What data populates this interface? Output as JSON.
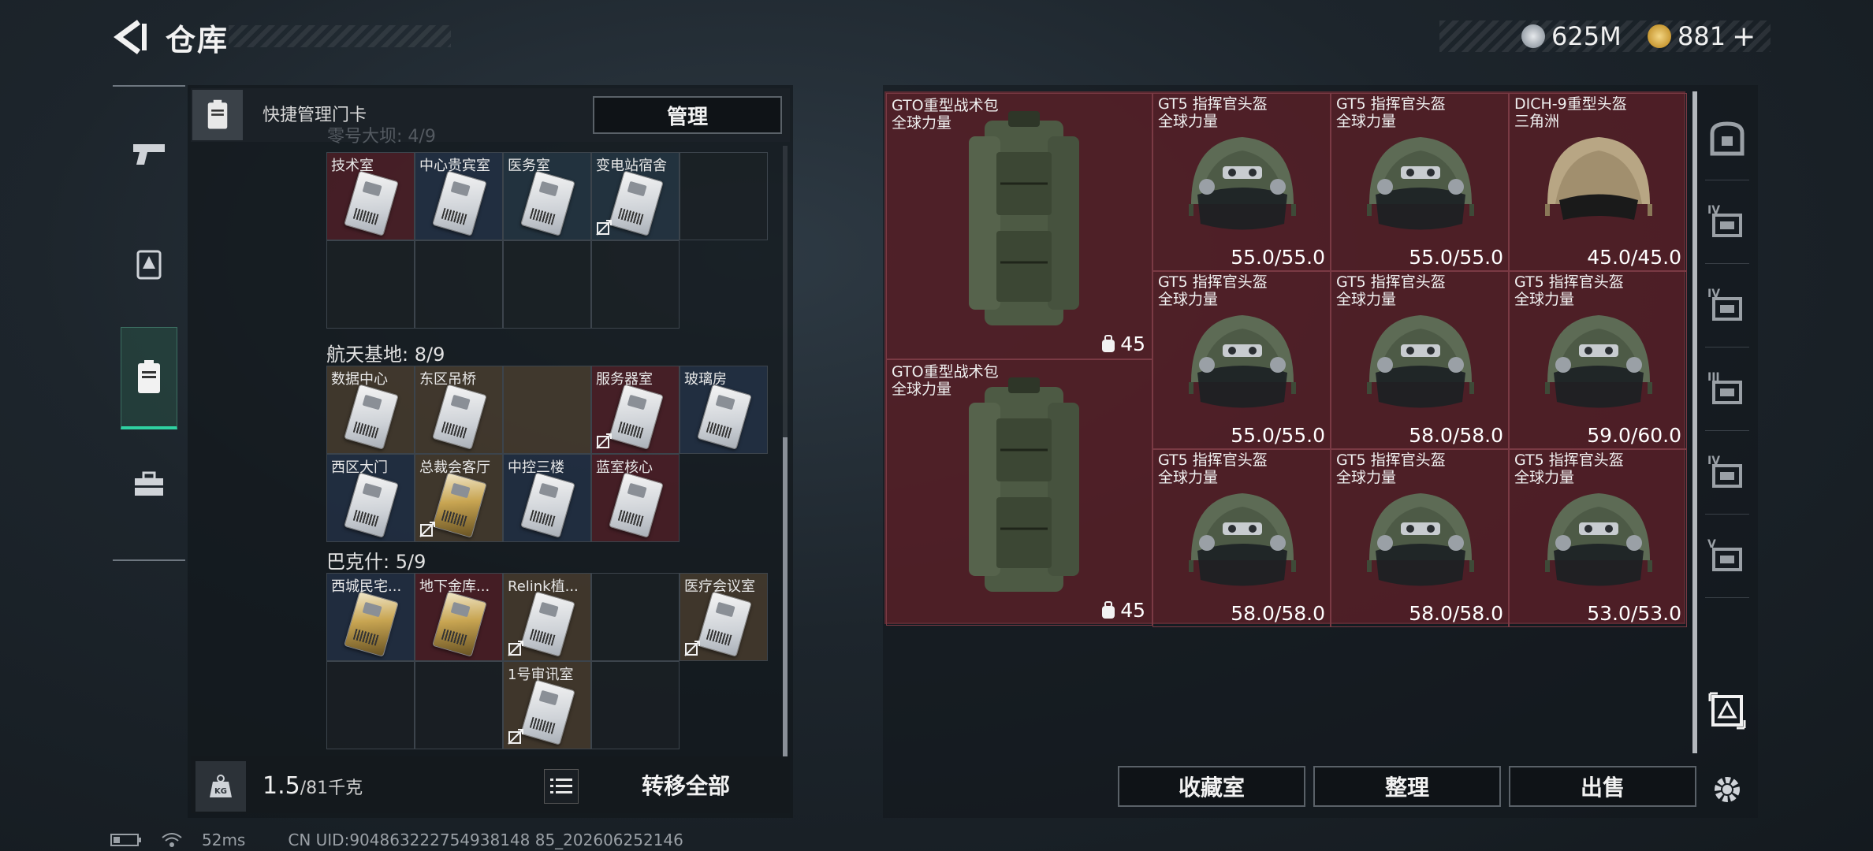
{
  "header": {
    "title": "仓库",
    "currency_1": "625M",
    "currency_2": "881",
    "currency_add": "+"
  },
  "left_nav": {
    "items": [
      "weapons-icon",
      "operator-icon",
      "keycard-icon",
      "toolbox-icon"
    ],
    "active": "keycard-icon"
  },
  "keycard_panel": {
    "quick_label": "快捷管理门卡",
    "manage_button": "管理",
    "ghost_section": "零号大坝: 4/9",
    "sections": [
      {
        "title": "",
        "rows": [
          [
            {
              "label": "技术室",
              "bg": "red",
              "nodrop": false
            },
            {
              "label": "中心贵宾室",
              "bg": "blue",
              "nodrop": false
            },
            {
              "label": "医务室",
              "bg": "teal",
              "nodrop": false
            },
            {
              "label": "变电站宿舍",
              "bg": "teal",
              "nodrop": true
            },
            {
              "label": "",
              "bg": "dark",
              "nodrop": false
            }
          ],
          [
            {
              "label": "",
              "bg": "dark"
            },
            {
              "label": "",
              "bg": "dark"
            },
            {
              "label": "",
              "bg": "dark"
            },
            {
              "label": "",
              "bg": "dark"
            },
            {
              "label": "",
              "bg": "empty"
            }
          ]
        ]
      },
      {
        "title": "航天基地: 8/9",
        "rows": [
          [
            {
              "label": "数据中心",
              "bg": "gold",
              "nodrop": false
            },
            {
              "label": "东区吊桥",
              "bg": "gold",
              "nodrop": false
            },
            {
              "label": "",
              "bg": "gold",
              "nodrop": false,
              "nocard": true
            },
            {
              "label": "服务器室",
              "bg": "red",
              "nodrop": true
            },
            {
              "label": "玻璃房",
              "bg": "blue",
              "nodrop": false
            }
          ],
          [
            {
              "label": "西区大门",
              "bg": "blue",
              "nodrop": false
            },
            {
              "label": "总裁会客厅",
              "bg": "gold",
              "nodrop": true,
              "gold": true
            },
            {
              "label": "中控三楼",
              "bg": "blue",
              "nodrop": false
            },
            {
              "label": "蓝室核心",
              "bg": "red",
              "nodrop": false
            },
            {
              "label": "",
              "bg": "empty"
            }
          ]
        ]
      },
      {
        "title": "巴克什: 5/9",
        "rows": [
          [
            {
              "label": "西城民宅...",
              "bg": "blue",
              "nodrop": false,
              "gold": true
            },
            {
              "label": "地下金库...",
              "bg": "red",
              "nodrop": false,
              "gold": true
            },
            {
              "label": "Relink植...",
              "bg": "gold",
              "nodrop": true
            },
            {
              "label": "",
              "bg": "dark",
              "nocard": true
            },
            {
              "label": "医疗会议室",
              "bg": "gold",
              "nodrop": true
            }
          ],
          [
            {
              "label": "",
              "bg": "dark"
            },
            {
              "label": "",
              "bg": "dark"
            },
            {
              "label": "1号审讯室",
              "bg": "gold",
              "nodrop": true
            },
            {
              "label": "",
              "bg": "dark"
            },
            {
              "label": "",
              "bg": "empty"
            }
          ]
        ]
      }
    ],
    "weight_value": "1.5",
    "weight_unit": "/81千克",
    "transfer_button": "转移全部"
  },
  "storage": {
    "bags": [
      {
        "name": "GTO重型战术包",
        "sub": "全球力量",
        "capacity": "45"
      },
      {
        "name": "GTO重型战术包",
        "sub": "全球力量",
        "capacity": "45"
      }
    ],
    "helmets": [
      {
        "name": "GT5 指挥官头盔",
        "sub": "全球力量",
        "dur": "55.0/55.0",
        "style": "green"
      },
      {
        "name": "GT5 指挥官头盔",
        "sub": "全球力量",
        "dur": "55.0/55.0",
        "style": "green"
      },
      {
        "name": "DICH-9重型头盔",
        "sub": "三角洲",
        "dur": "45.0/45.0",
        "style": "tan"
      },
      {
        "name": "GT5 指挥官头盔",
        "sub": "全球力量",
        "dur": "55.0/55.0",
        "style": "green"
      },
      {
        "name": "GT5 指挥官头盔",
        "sub": "全球力量",
        "dur": "58.0/58.0",
        "style": "green"
      },
      {
        "name": "GT5 指挥官头盔",
        "sub": "全球力量",
        "dur": "59.0/60.0",
        "style": "green"
      },
      {
        "name": "GT5 指挥官头盔",
        "sub": "全球力量",
        "dur": "58.0/58.0",
        "style": "green"
      },
      {
        "name": "GT5 指挥官头盔",
        "sub": "全球力量",
        "dur": "58.0/58.0",
        "style": "green"
      },
      {
        "name": "GT5 指挥官头盔",
        "sub": "全球力量",
        "dur": "53.0/53.0",
        "style": "green"
      }
    ],
    "buttons": [
      "收藏室",
      "整理",
      "出售"
    ]
  },
  "right_side": {
    "items": [
      "safe-box-icon",
      "container-iv-1-icon",
      "container-iv-2-icon",
      "container-iii-icon",
      "container-iv-add-icon",
      "container-v-icon",
      "delta-box-icon",
      "settings-icon"
    ],
    "roman": [
      "",
      "IV",
      "IV",
      "III",
      "IV",
      "V",
      "",
      ""
    ]
  },
  "status": {
    "ping": "52ms",
    "uid": "CN UID:904863222754938148 85_202606252146"
  },
  "colors": {
    "accent": "#2fd1a1",
    "item_bg_red": "#60202a",
    "panel_bg": "#12171c"
  }
}
